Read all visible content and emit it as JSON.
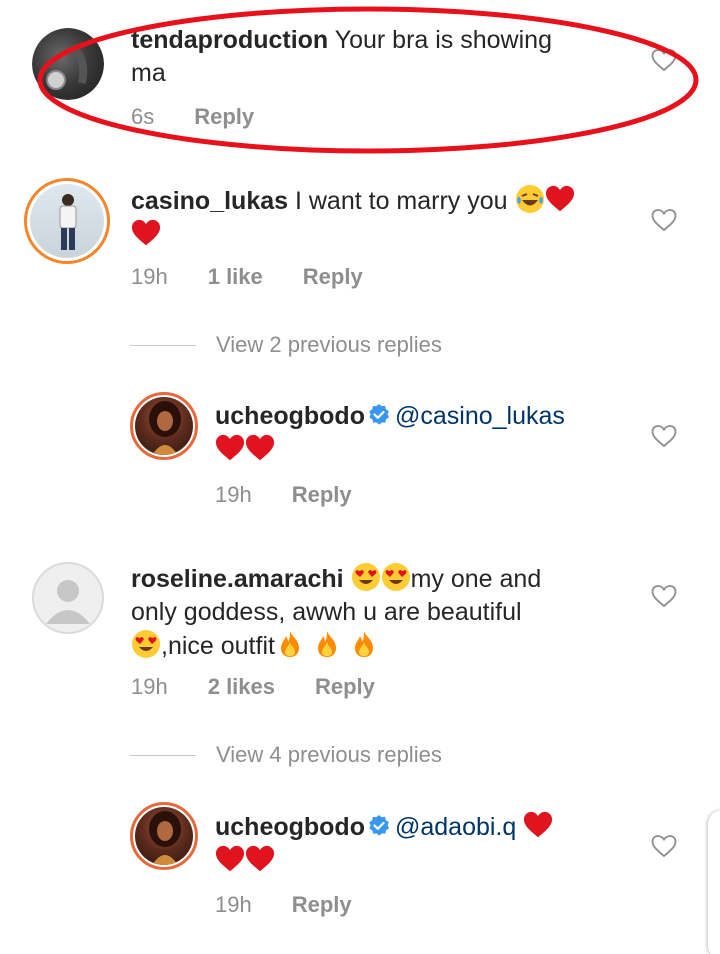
{
  "comments": [
    {
      "username": "tendaproduction",
      "text_line1": " Your bra is showing",
      "text_line2": "ma",
      "time": "6s",
      "reply": "Reply"
    },
    {
      "username": "casino_lukas",
      "text_line1": " I want to marry you",
      "time": "19h",
      "likes": "1 like",
      "reply": "Reply"
    },
    {
      "view_replies": "View 2 previous replies",
      "username": "ucheogbodo",
      "mention": "@casino_lukas",
      "time": "19h",
      "reply": "Reply"
    },
    {
      "username": "roseline.amarachi",
      "text_line1": "my one and",
      "text_line2": "only goddess, awwh u are beautiful",
      "text_line3": ",nice outfit",
      "time": "19h",
      "likes": "2 likes",
      "reply": "Reply"
    },
    {
      "view_replies": "View 4 previous replies",
      "username": "ucheogbodo",
      "mention": "@adaobi.q",
      "time": "19h",
      "reply": "Reply"
    }
  ],
  "colors": {
    "annotation": "#e8101a",
    "verified": "#3897f0",
    "heart": "#e0131e"
  }
}
